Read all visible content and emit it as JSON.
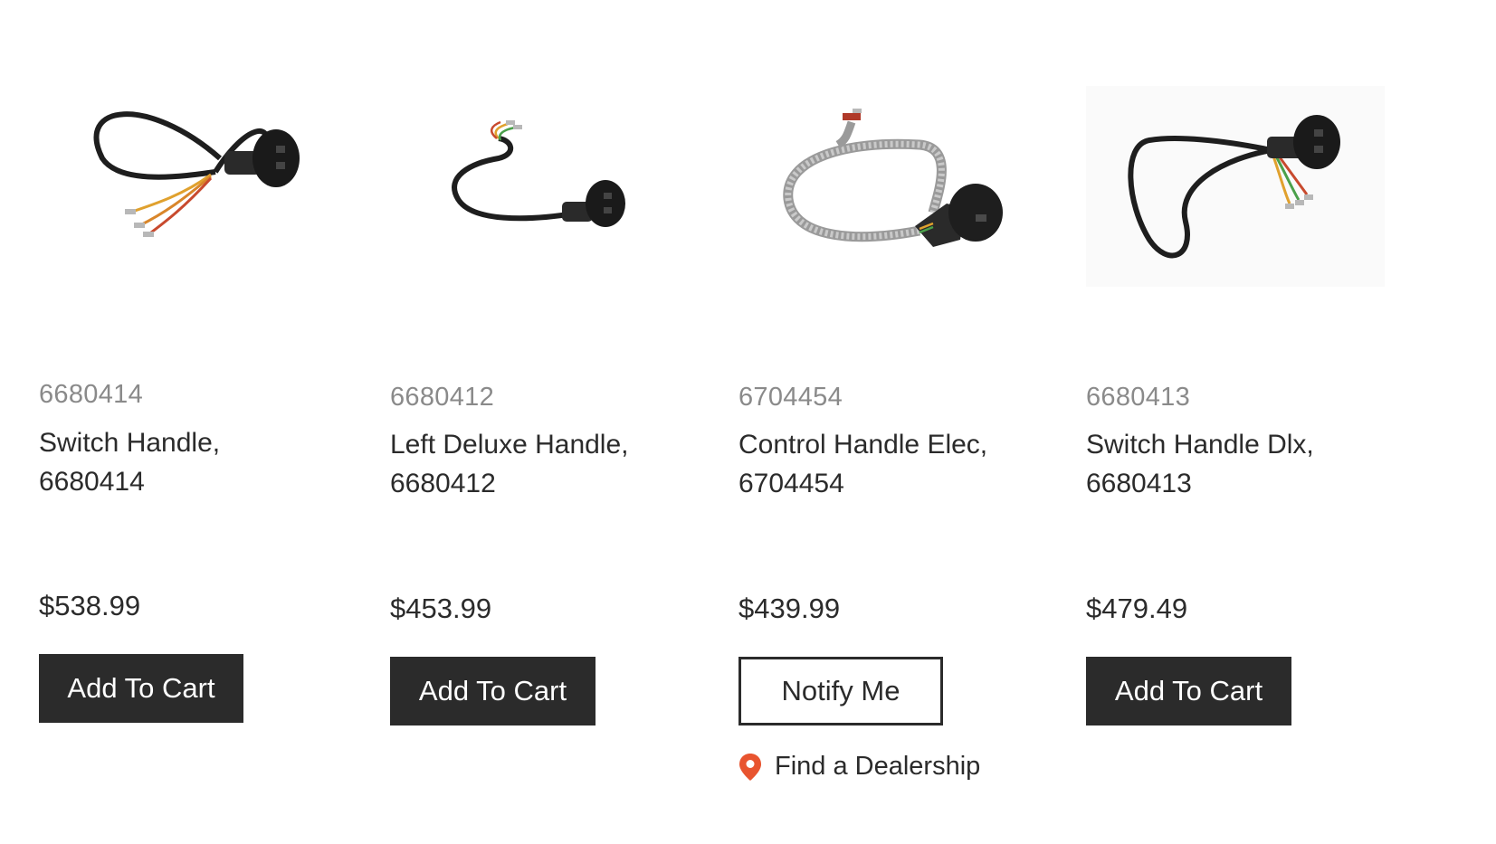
{
  "products": [
    {
      "sku": "6680414",
      "title_line1": "Switch Handle,",
      "title_line2": "6680414",
      "price": "$538.99",
      "action_label": "Add To Cart"
    },
    {
      "sku": "6680412",
      "title_line1": "Left Deluxe Handle,",
      "title_line2": "6680412",
      "price": "$453.99",
      "action_label": "Add To Cart"
    },
    {
      "sku": "6704454",
      "title_line1": "Control Handle Elec,",
      "title_line2": "6704454",
      "price": "$439.99",
      "action_label": "Notify Me",
      "dealer_label": "Find a Dealership"
    },
    {
      "sku": "6680413",
      "title_line1": "Switch Handle Dlx,",
      "title_line2": "6680413",
      "price": "$479.49",
      "action_label": "Add To Cart"
    }
  ],
  "icons": {
    "dealer": "map-pin-icon"
  },
  "colors": {
    "button_dark": "#2b2b2b",
    "pin_accent": "#e8542f",
    "sku_gray": "#8a8a8a"
  }
}
